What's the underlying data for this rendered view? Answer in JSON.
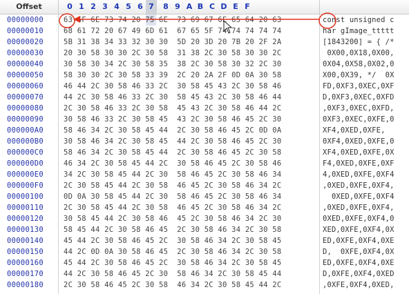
{
  "header": {
    "offset_label": "Offset",
    "columns": [
      "0",
      "1",
      "2",
      "3",
      "4",
      "5",
      "6",
      "7",
      "8",
      "9",
      "A",
      "B",
      "C",
      "D",
      "E",
      "F"
    ]
  },
  "rows": [
    {
      "offset": "00000000",
      "hex": "63 6F 6E 73 74 20 75 6E  73 69 67 6E 65 64 20 63",
      "text": "const unsigned c"
    },
    {
      "offset": "00000010",
      "hex": "68 61 72 20 67 49 6D 61  67 65 5F 74 74 74 74 74",
      "text": "har gImage_ttttt"
    },
    {
      "offset": "00000020",
      "hex": "5B 31 38 34 33 32 30 30  5D 20 3D 20 7B 20 2F 2A",
      "text": "[1843200] = { /*"
    },
    {
      "offset": "00000030",
      "hex": "20 30 58 30 30 2C 30 58  31 38 2C 30 58 30 30 2C",
      "text": " 0X00,0X18,0X00,"
    },
    {
      "offset": "00000040",
      "hex": "30 58 30 34 2C 30 58 35  38 2C 30 58 30 32 2C 30",
      "text": "0X04,0X58,0X02,0"
    },
    {
      "offset": "00000050",
      "hex": "58 30 30 2C 30 58 33 39  2C 20 2A 2F 0D 0A 30 58",
      "text": "X00,0X39, */  0X"
    },
    {
      "offset": "00000060",
      "hex": "46 44 2C 30 58 46 33 2C  30 58 45 43 2C 30 58 46",
      "text": "FD,0XF3,0XEC,0XF"
    },
    {
      "offset": "00000070",
      "hex": "44 2C 30 58 46 33 2C 30  58 45 43 2C 30 58 46 44",
      "text": "D,0XF3,0XEC,0XFD"
    },
    {
      "offset": "00000080",
      "hex": "2C 30 58 46 33 2C 30 58  45 43 2C 30 58 46 44 2C",
      "text": ",0XF3,0XEC,0XFD,"
    },
    {
      "offset": "00000090",
      "hex": "30 58 46 33 2C 30 58 45  43 2C 30 58 46 45 2C 30",
      "text": "0XF3,0XEC,0XFE,0"
    },
    {
      "offset": "000000A0",
      "hex": "58 46 34 2C 30 58 45 44  2C 30 58 46 45 2C 0D 0A",
      "text": "XF4,0XED,0XFE,  "
    },
    {
      "offset": "000000B0",
      "hex": "30 58 46 34 2C 30 58 45  44 2C 30 58 46 45 2C 30",
      "text": "0XF4,0XED,0XFE,0"
    },
    {
      "offset": "000000C0",
      "hex": "58 46 34 2C 30 58 45 44  2C 30 58 46 45 2C 30 58",
      "text": "XF4,0XED,0XFE,0X"
    },
    {
      "offset": "000000D0",
      "hex": "46 34 2C 30 58 45 44 2C  30 58 46 45 2C 30 58 46",
      "text": "F4,0XED,0XFE,0XF"
    },
    {
      "offset": "000000E0",
      "hex": "34 2C 30 58 45 44 2C 30  58 46 45 2C 30 58 46 34",
      "text": "4,0XED,0XFE,0XF4"
    },
    {
      "offset": "000000F0",
      "hex": "2C 30 58 45 44 2C 30 58  46 45 2C 30 58 46 34 2C",
      "text": ",0XED,0XFE,0XF4,"
    },
    {
      "offset": "00000100",
      "hex": "0D 0A 30 58 45 44 2C 30  58 46 45 2C 30 58 46 34",
      "text": "  0XED,0XFE,0XF4"
    },
    {
      "offset": "00000110",
      "hex": "2C 30 58 45 44 2C 30 58  46 45 2C 30 58 46 34 2C",
      "text": ",0XED,0XFE,0XF4,"
    },
    {
      "offset": "00000120",
      "hex": "30 58 45 44 2C 30 58 46  45 2C 30 58 46 34 2C 30",
      "text": "0XED,0XFE,0XF4,0"
    },
    {
      "offset": "00000130",
      "hex": "58 45 44 2C 30 58 46 45  2C 30 58 46 34 2C 30 58",
      "text": "XED,0XFE,0XF4,0X"
    },
    {
      "offset": "00000140",
      "hex": "45 44 2C 30 58 46 45 2C  30 58 46 34 2C 30 58 45",
      "text": "ED,0XFE,0XF4,0XE"
    },
    {
      "offset": "00000150",
      "hex": "44 2C 0D 0A 30 58 46 45  2C 30 58 46 34 2C 30 58",
      "text": "D,  0XFE,0XF4,0X"
    },
    {
      "offset": "00000160",
      "hex": "45 44 2C 30 58 46 45 2C  30 58 46 34 2C 30 58 45",
      "text": "ED,0XFE,0XF4,0XE"
    },
    {
      "offset": "00000170",
      "hex": "44 2C 30 58 46 45 2C 30  58 46 34 2C 30 58 45 44",
      "text": "D,0XFE,0XF4,0XED"
    },
    {
      "offset": "00000180",
      "hex": "2C 30 58 46 45 2C 30 58  46 34 2C 30 58 45 44 2C",
      "text": ",0XFE,0XF4,0XED,"
    }
  ],
  "colors": {
    "offset_text": "#2233aa",
    "header_text": "#1a36b5",
    "annotation_red": "#e0301e"
  },
  "icons": [
    "mouse-pointer-icon"
  ]
}
